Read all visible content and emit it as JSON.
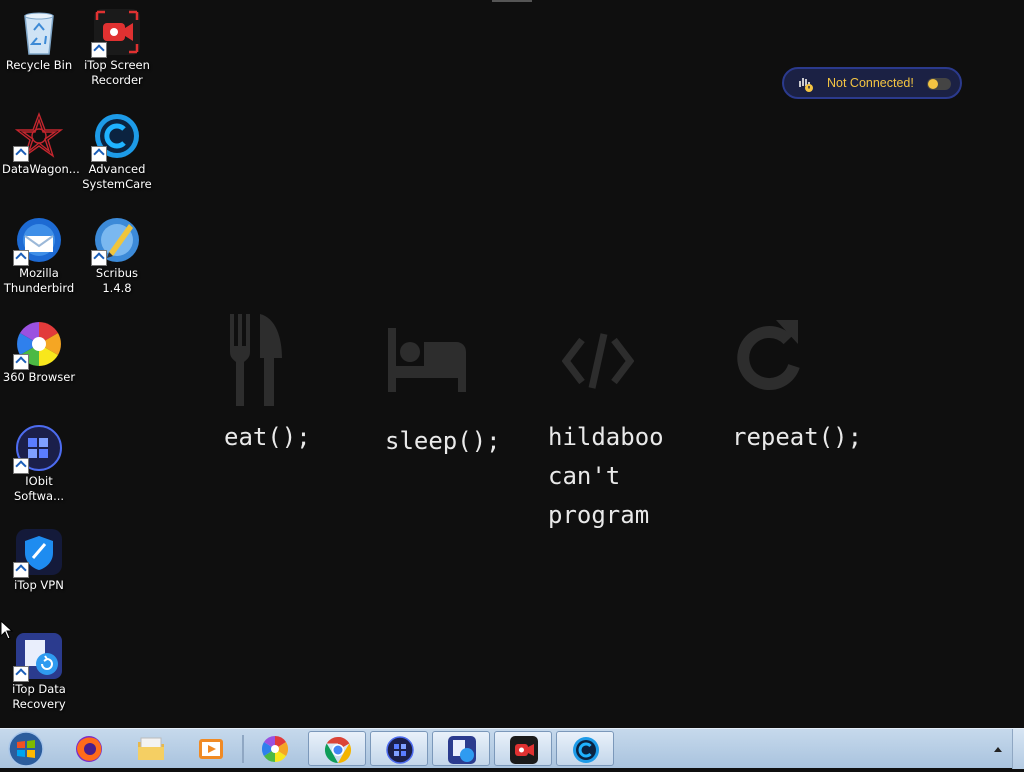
{
  "desktop": {
    "icons": [
      {
        "label": "Recycle Bin"
      },
      {
        "label": "iTop Screen Recorder"
      },
      {
        "label": "DataWagon..."
      },
      {
        "label": "Advanced SystemCare"
      },
      {
        "label": "Mozilla Thunderbird"
      },
      {
        "label": "Scribus 1.4.8"
      },
      {
        "label": "360 Browser"
      },
      {
        "label": "IObit Softwa..."
      },
      {
        "label": "iTop VPN"
      },
      {
        "label": "iTop Data Recovery"
      }
    ]
  },
  "wallpaper": {
    "eat": "eat();",
    "sleep": "sleep();",
    "code_line1": "hildaboo",
    "code_line2": "can't",
    "code_line3": "program",
    "repeat": "repeat();"
  },
  "vpn_widget": {
    "status": "Not Connected!"
  },
  "colors": {
    "desktop_bg": "#0f0f0f",
    "taskbar": "#b7cde3",
    "vpn_text": "#f4c542"
  },
  "taskbar": {
    "items": [
      {
        "icon": "windows-start-icon"
      },
      {
        "icon": "firefox-icon"
      },
      {
        "icon": "file-explorer-icon"
      },
      {
        "icon": "media-player-icon"
      },
      {
        "icon": "360-browser-icon"
      },
      {
        "icon": "chrome-icon"
      },
      {
        "icon": "iobit-icon"
      },
      {
        "icon": "itop-data-recovery-icon"
      },
      {
        "icon": "itop-screen-recorder-icon"
      },
      {
        "icon": "advanced-systemcare-icon"
      },
      {
        "icon": "show-hidden-icons-icon"
      }
    ]
  }
}
